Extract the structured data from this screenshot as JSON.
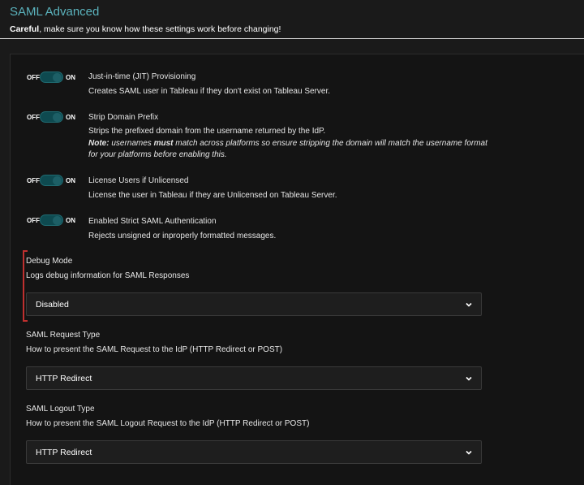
{
  "header": {
    "title": "SAML Advanced",
    "warning_bold": "Careful",
    "warning_rest": ", make sure you know how these settings work before changing!"
  },
  "toggles": [
    {
      "off_label": "OFF",
      "on_label": "ON",
      "state": "on",
      "name": "Just-in-time (JIT) Provisioning",
      "desc": "Creates SAML user in Tableau if they don't exist on Tableau Server."
    },
    {
      "off_label": "OFF",
      "on_label": "ON",
      "state": "on",
      "name": "Strip Domain Prefix",
      "desc": "Strips the prefixed domain from the username returned by the IdP.",
      "note_label": "Note:",
      "note_pre": " usernames ",
      "note_bold": "must",
      "note_post": " match across platforms so ensure stripping the domain will match the username format for your platforms before enabling this."
    },
    {
      "off_label": "OFF",
      "on_label": "ON",
      "state": "on",
      "name": "License Users if Unlicensed",
      "desc": "License the user in Tableau if they are Unlicensed on Tableau Server."
    },
    {
      "off_label": "OFF",
      "on_label": "ON",
      "state": "on",
      "name": "Enabled Strict SAML Authentication",
      "desc": "Rejects unsigned or inproperly formatted messages."
    }
  ],
  "selects": [
    {
      "label": "Debug Mode",
      "desc": "Logs debug information for SAML Responses",
      "value": "Disabled"
    },
    {
      "label": "SAML Request Type",
      "desc": "How to present the SAML Request to the IdP (HTTP Redirect or POST)",
      "value": "HTTP Redirect"
    },
    {
      "label": "SAML Logout Type",
      "desc": "How to present the SAML Logout Request to the IdP (HTTP Redirect or POST)",
      "value": "HTTP Redirect"
    }
  ],
  "colors": {
    "accent": "#5bb3bd",
    "toggle_on": "#0e4a50",
    "marker": "#c0302f"
  }
}
